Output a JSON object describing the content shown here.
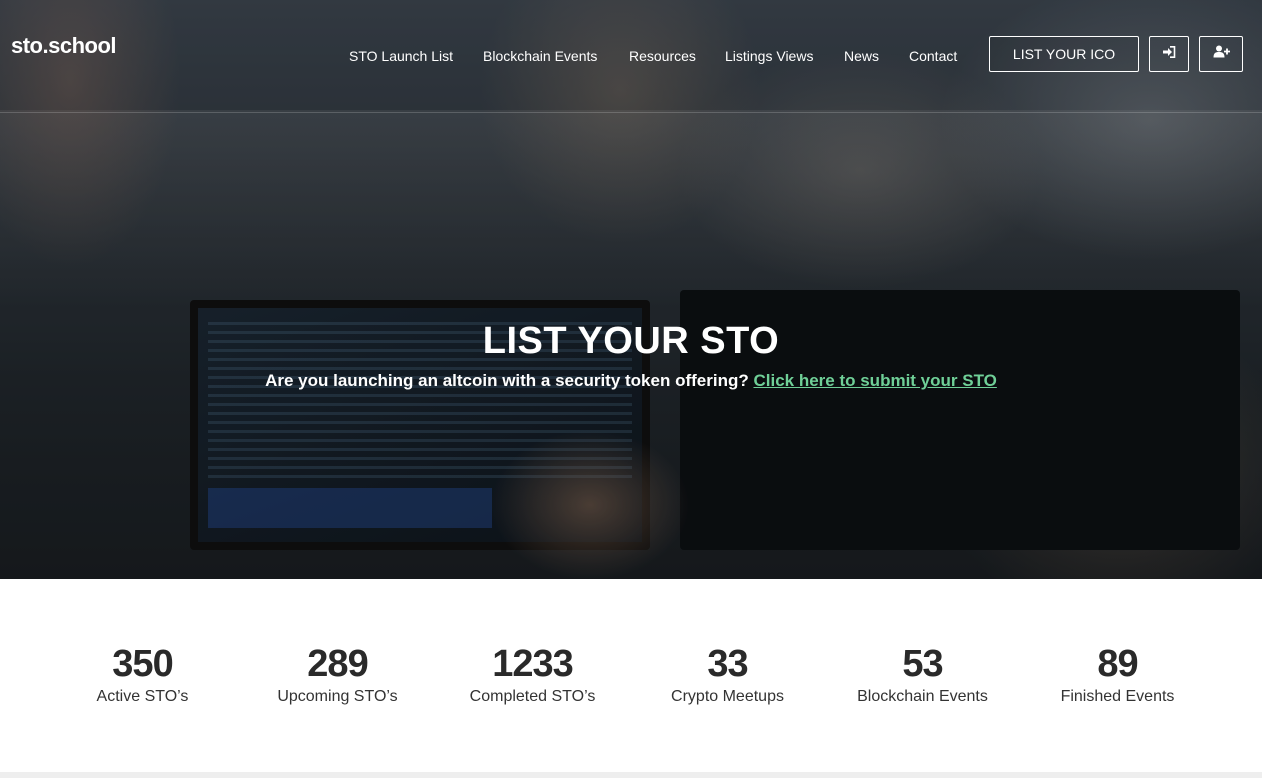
{
  "header": {
    "logo": "sto.school",
    "nav": [
      {
        "label": "STO Launch List"
      },
      {
        "label": "Blockchain Events"
      },
      {
        "label": "Resources"
      },
      {
        "label": "Listings Views"
      },
      {
        "label": "News"
      },
      {
        "label": "Contact"
      }
    ],
    "list_button_label": "LIST YOUR ICO",
    "login_icon": "sign-in-icon",
    "signup_icon": "user-plus-icon"
  },
  "hero": {
    "title": "LIST YOUR STO",
    "subtitle": "Are you launching an altcoin with a security token offering?",
    "link_text": "Click here to submit your STO"
  },
  "stats": [
    {
      "value": "350",
      "label": "Active STO’s"
    },
    {
      "value": "289",
      "label": "Upcoming STO’s"
    },
    {
      "value": "1233",
      "label": "Completed STO’s"
    },
    {
      "value": "33",
      "label": "Crypto Meetups"
    },
    {
      "value": "53",
      "label": "Blockchain Events"
    },
    {
      "value": "89",
      "label": "Finished Events"
    }
  ],
  "colors": {
    "link": "#6fcf97",
    "text_dark": "#2a2a2a"
  }
}
